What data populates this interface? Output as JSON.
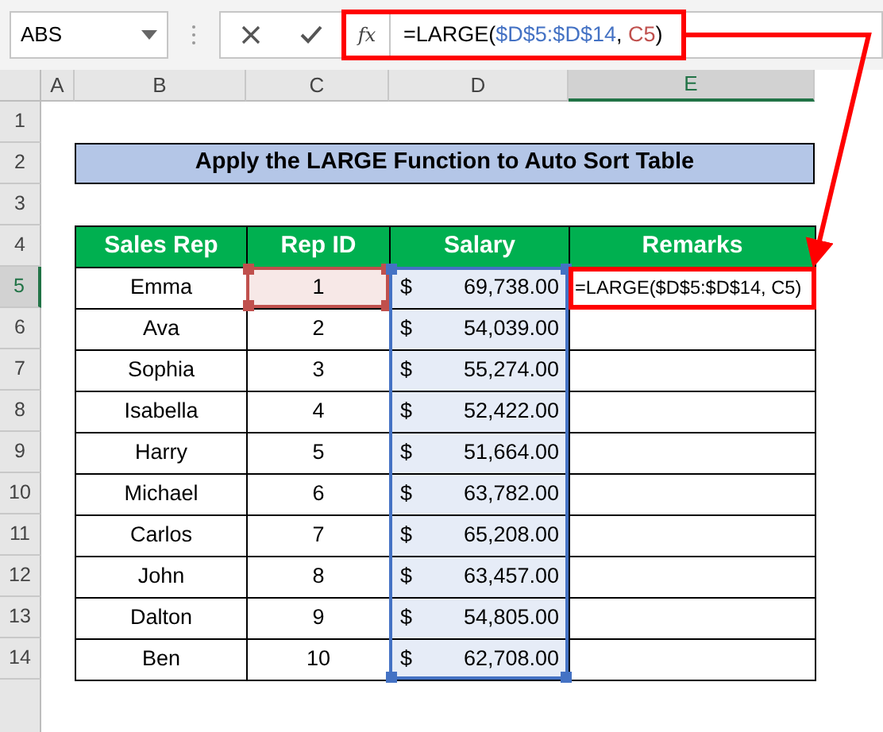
{
  "name_box": {
    "value": "ABS"
  },
  "formula_bar": {
    "fx": "fx",
    "parts": [
      {
        "text": "=LARGE(",
        "color": "#000000"
      },
      {
        "text": "$D$5:$D$14",
        "color": "#4472c4"
      },
      {
        "text": ", ",
        "color": "#000000"
      },
      {
        "text": "C5",
        "color": "#c0504d"
      },
      {
        "text": ")",
        "color": "#000000"
      }
    ]
  },
  "columns": [
    {
      "label": "A",
      "selected": false
    },
    {
      "label": "B",
      "selected": false
    },
    {
      "label": "C",
      "selected": false
    },
    {
      "label": "D",
      "selected": false
    },
    {
      "label": "E",
      "selected": true
    }
  ],
  "rows": [
    {
      "label": "1",
      "selected": false
    },
    {
      "label": "2",
      "selected": false
    },
    {
      "label": "3",
      "selected": false
    },
    {
      "label": "4",
      "selected": false
    },
    {
      "label": "5",
      "selected": true
    },
    {
      "label": "6",
      "selected": false
    },
    {
      "label": "7",
      "selected": false
    },
    {
      "label": "8",
      "selected": false
    },
    {
      "label": "9",
      "selected": false
    },
    {
      "label": "10",
      "selected": false
    },
    {
      "label": "11",
      "selected": false
    },
    {
      "label": "12",
      "selected": false
    },
    {
      "label": "13",
      "selected": false
    },
    {
      "label": "14",
      "selected": false
    }
  ],
  "title": "Apply the LARGE Function to Auto Sort Table",
  "table": {
    "columns": [
      "Sales Rep",
      "Rep ID",
      "Salary",
      "Remarks"
    ],
    "rows": [
      {
        "sales_rep": "Emma",
        "rep_id": "1",
        "rep_id_highlight": {
          "color": "#c0504d"
        },
        "currency": "$",
        "salary": "69,738.00",
        "salary_highlight": {
          "color": "#4472c4"
        },
        "remarks": "=LARGE($D$5:$D$14, C5)"
      },
      {
        "sales_rep": "Ava",
        "rep_id": "2",
        "currency": "$",
        "salary": "54,039.00",
        "salary_highlight": {
          "color": "#4472c4"
        }
      },
      {
        "sales_rep": "Sophia",
        "rep_id": "3",
        "currency": "$",
        "salary": "55,274.00",
        "salary_highlight": {
          "color": "#4472c4"
        }
      },
      {
        "sales_rep": "Isabella",
        "rep_id": "4",
        "currency": "$",
        "salary": "52,422.00",
        "salary_highlight": {
          "color": "#4472c4"
        }
      },
      {
        "sales_rep": "Harry",
        "rep_id": "5",
        "currency": "$",
        "salary": "51,664.00",
        "salary_highlight": {
          "color": "#4472c4"
        }
      },
      {
        "sales_rep": "Michael",
        "rep_id": "6",
        "currency": "$",
        "salary": "63,782.00",
        "salary_highlight": {
          "color": "#4472c4"
        }
      },
      {
        "sales_rep": "Carlos",
        "rep_id": "7",
        "currency": "$",
        "salary": "65,208.00",
        "salary_highlight": {
          "color": "#4472c4"
        }
      },
      {
        "sales_rep": "John",
        "rep_id": "8",
        "currency": "$",
        "salary": "63,457.00",
        "salary_highlight": {
          "color": "#4472c4"
        }
      },
      {
        "sales_rep": "Dalton",
        "rep_id": "9",
        "currency": "$",
        "salary": "54,805.00",
        "salary_highlight": {
          "color": "#4472c4"
        }
      },
      {
        "sales_rep": "Ben",
        "rep_id": "10",
        "currency": "$",
        "salary": "62,708.00",
        "salary_highlight": {
          "color": "#4472c4"
        }
      }
    ]
  }
}
